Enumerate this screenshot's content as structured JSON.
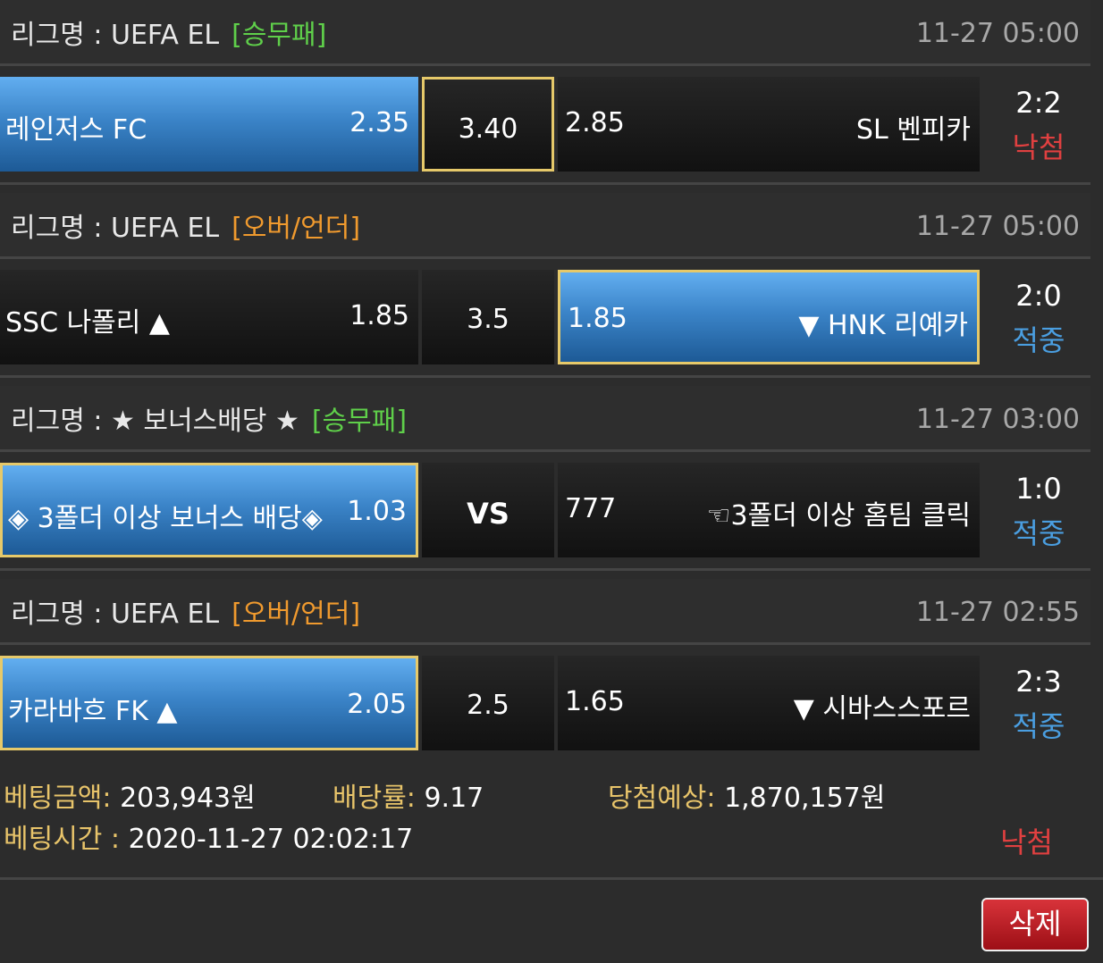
{
  "matches": [
    {
      "league_label": "리그명 : UEFA EL",
      "tag": "[승무패]",
      "time": "11-27 05:00",
      "home_team": "레인저스 FC",
      "home_odds": "2.35",
      "middle": "3.40",
      "away_odds": "2.85",
      "away_team": "SL 벤피카",
      "score": "2:2",
      "status": "낙첨"
    },
    {
      "league_label": "리그명 : UEFA EL",
      "tag": "[오버/언더]",
      "time": "11-27 05:00",
      "home_team": "SSC 나폴리 ▲",
      "home_odds": "1.85",
      "middle": "3.5",
      "away_odds": "1.85",
      "away_team": "▼ HNK 리예카",
      "score": "2:0",
      "status": "적중"
    },
    {
      "league_label": "리그명 : ★ 보너스배당 ★",
      "tag": "[승무패]",
      "time": "11-27 03:00",
      "home_team": "◈ 3폴더 이상 보너스 배당◈",
      "home_odds": "1.03",
      "middle": "VS",
      "away_odds": "777",
      "away_team": "☜3폴더 이상 홈팀 클릭",
      "score": "1:0",
      "status": "적중"
    },
    {
      "league_label": "리그명 : UEFA EL",
      "tag": "[오버/언더]",
      "time": "11-27 02:55",
      "home_team": "카라바흐 FK ▲",
      "home_odds": "2.05",
      "middle": "2.5",
      "away_odds": "1.65",
      "away_team": "▼ 시바스스포르",
      "score": "2:3",
      "status": "적중"
    }
  ],
  "summary": {
    "bet_amount_label": "베팅금액:",
    "bet_amount": "203,943원",
    "odds_label": "배당률:",
    "odds": "9.17",
    "expected_label": "당첨예상:",
    "expected": "1,870,157원",
    "bet_time_label": "베팅시간 :",
    "bet_time": "2020-11-27 02:02:17",
    "status": "낙첨"
  },
  "delete_label": "삭제",
  "colors": {
    "selected_blue": "#3b84c8",
    "highlight_border": "#e6c96a",
    "tag_green": "#5fcf4a",
    "tag_orange": "#f09a2e",
    "win_blue": "#4a9ee0",
    "lose_red": "#e04040",
    "label_gold": "#e8c46a"
  }
}
